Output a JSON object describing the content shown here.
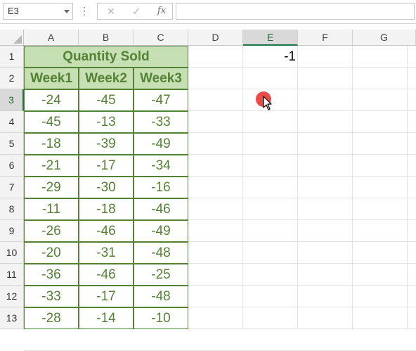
{
  "formula_bar": {
    "name_box": "E3",
    "cancel_icon": "✕",
    "enter_icon": "✓",
    "function_icon": "fx",
    "formula": ""
  },
  "columns": [
    "A",
    "B",
    "C",
    "D",
    "E",
    "F",
    "G"
  ],
  "selected_column": "E",
  "rows": [
    "1",
    "2",
    "3",
    "4",
    "5",
    "6",
    "7",
    "8",
    "9",
    "10",
    "11",
    "12",
    "13"
  ],
  "selected_row": "3",
  "table": {
    "title": "Quantity Sold",
    "headers": [
      "Week1",
      "Week2",
      "Week3"
    ],
    "data": [
      [
        "-24",
        "-45",
        "-47"
      ],
      [
        "-45",
        "-13",
        "-33"
      ],
      [
        "-18",
        "-39",
        "-49"
      ],
      [
        "-21",
        "-17",
        "-34"
      ],
      [
        "-29",
        "-30",
        "-16"
      ],
      [
        "-11",
        "-18",
        "-46"
      ],
      [
        "-26",
        "-46",
        "-49"
      ],
      [
        "-20",
        "-31",
        "-48"
      ],
      [
        "-36",
        "-46",
        "-25"
      ],
      [
        "-33",
        "-17",
        "-48"
      ],
      [
        "-28",
        "-14",
        "-10"
      ]
    ]
  },
  "cell_e1": "-1",
  "colors": {
    "header_fill": "#c6e0b4",
    "accent_green": "#548235",
    "selection_green": "#217346",
    "cursor_highlight": "#e53935"
  }
}
